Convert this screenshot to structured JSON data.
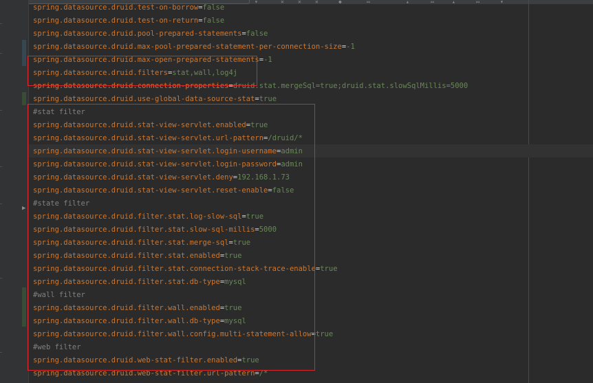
{
  "toolbar": {
    "icons": [
      "filter-icon",
      "close-all-icon",
      "close-icon",
      "pin-icon",
      "window-icon",
      "move-icon",
      "layout-icon",
      "export-icon",
      "grid-icon",
      "arrow-icon"
    ]
  },
  "colors": {
    "key": "#cc7832",
    "value": "#6a8759",
    "comment": "#808080",
    "highlight_box": "#d9272e"
  },
  "editor": {
    "lines": [
      {
        "type": "prop",
        "key": "spring.datasource.druid.test-on-borrow",
        "value": "false"
      },
      {
        "type": "prop",
        "key": "spring.datasource.druid.test-on-return",
        "value": "false"
      },
      {
        "type": "prop",
        "key": "spring.datasource.druid.pool-prepared-statements",
        "value": "false"
      },
      {
        "type": "prop",
        "key": "spring.datasource.druid.max-pool-prepared-statement-per-connection-size",
        "value": "-1"
      },
      {
        "type": "prop",
        "key": "spring.datasource.druid.max-open-prepared-statements",
        "value": "-1"
      },
      {
        "type": "prop",
        "key": "spring.datasource.druid.filters",
        "value": "stat,wall,log4j"
      },
      {
        "type": "prop",
        "key": "spring.datasource.druid.connection-properties",
        "value": "druid.stat.mergeSql=true;druid.stat.slowSqlMillis=5000"
      },
      {
        "type": "prop",
        "key": "spring.datasource.druid.use-global-data-source-stat",
        "value": "true"
      },
      {
        "type": "comment",
        "text": "#stat filter"
      },
      {
        "type": "prop",
        "key": "spring.datasource.druid.stat-view-servlet.enabled",
        "value": "true"
      },
      {
        "type": "prop",
        "key": "spring.datasource.druid.stat-view-servlet.url-pattern",
        "value": "/druid/*"
      },
      {
        "type": "prop",
        "key": "spring.datasource.druid.stat-view-servlet.login-username",
        "value": "admin"
      },
      {
        "type": "prop",
        "key": "spring.datasource.druid.stat-view-servlet.login-password",
        "value": "admin"
      },
      {
        "type": "prop",
        "key": "spring.datasource.druid.stat-view-servlet.deny",
        "value": "192.168.1.73"
      },
      {
        "type": "prop",
        "key": "spring.datasource.druid.stat-view-servlet.reset-enable",
        "value": "false"
      },
      {
        "type": "comment",
        "text": "#state filter"
      },
      {
        "type": "prop",
        "key": "spring.datasource.druid.filter.stat.log-slow-sql",
        "value": "true"
      },
      {
        "type": "prop",
        "key": "spring.datasource.druid.filter.stat.slow-sql-millis",
        "value": "5000"
      },
      {
        "type": "prop",
        "key": "spring.datasource.druid.filter.stat.merge-sql",
        "value": "true"
      },
      {
        "type": "prop",
        "key": "spring.datasource.druid.filter.stat.enabled",
        "value": "true"
      },
      {
        "type": "prop",
        "key": "spring.datasource.druid.filter.stat.connection-stack-trace-enable",
        "value": "true"
      },
      {
        "type": "prop",
        "key": "spring.datasource.druid.filter.stat.db-type",
        "value": "mysql"
      },
      {
        "type": "comment",
        "text": "#wall filter"
      },
      {
        "type": "prop",
        "key": "spring.datasource.druid.filter.wall.enabled",
        "value": "true"
      },
      {
        "type": "prop",
        "key": "spring.datasource.druid.filter.wall.db-type",
        "value": "mysql"
      },
      {
        "type": "prop",
        "key": "spring.datasource.druid.filter.wall.config.multi-statement-allow",
        "value": "true"
      },
      {
        "type": "comment",
        "text": "#web filter"
      },
      {
        "type": "prop",
        "key": "spring.datasource.druid.web-stat-filter.enabled",
        "value": "true"
      },
      {
        "type": "prop",
        "key": "spring.datasource.druid.web-stat-filter.url-pattern",
        "value": "/*"
      }
    ]
  }
}
